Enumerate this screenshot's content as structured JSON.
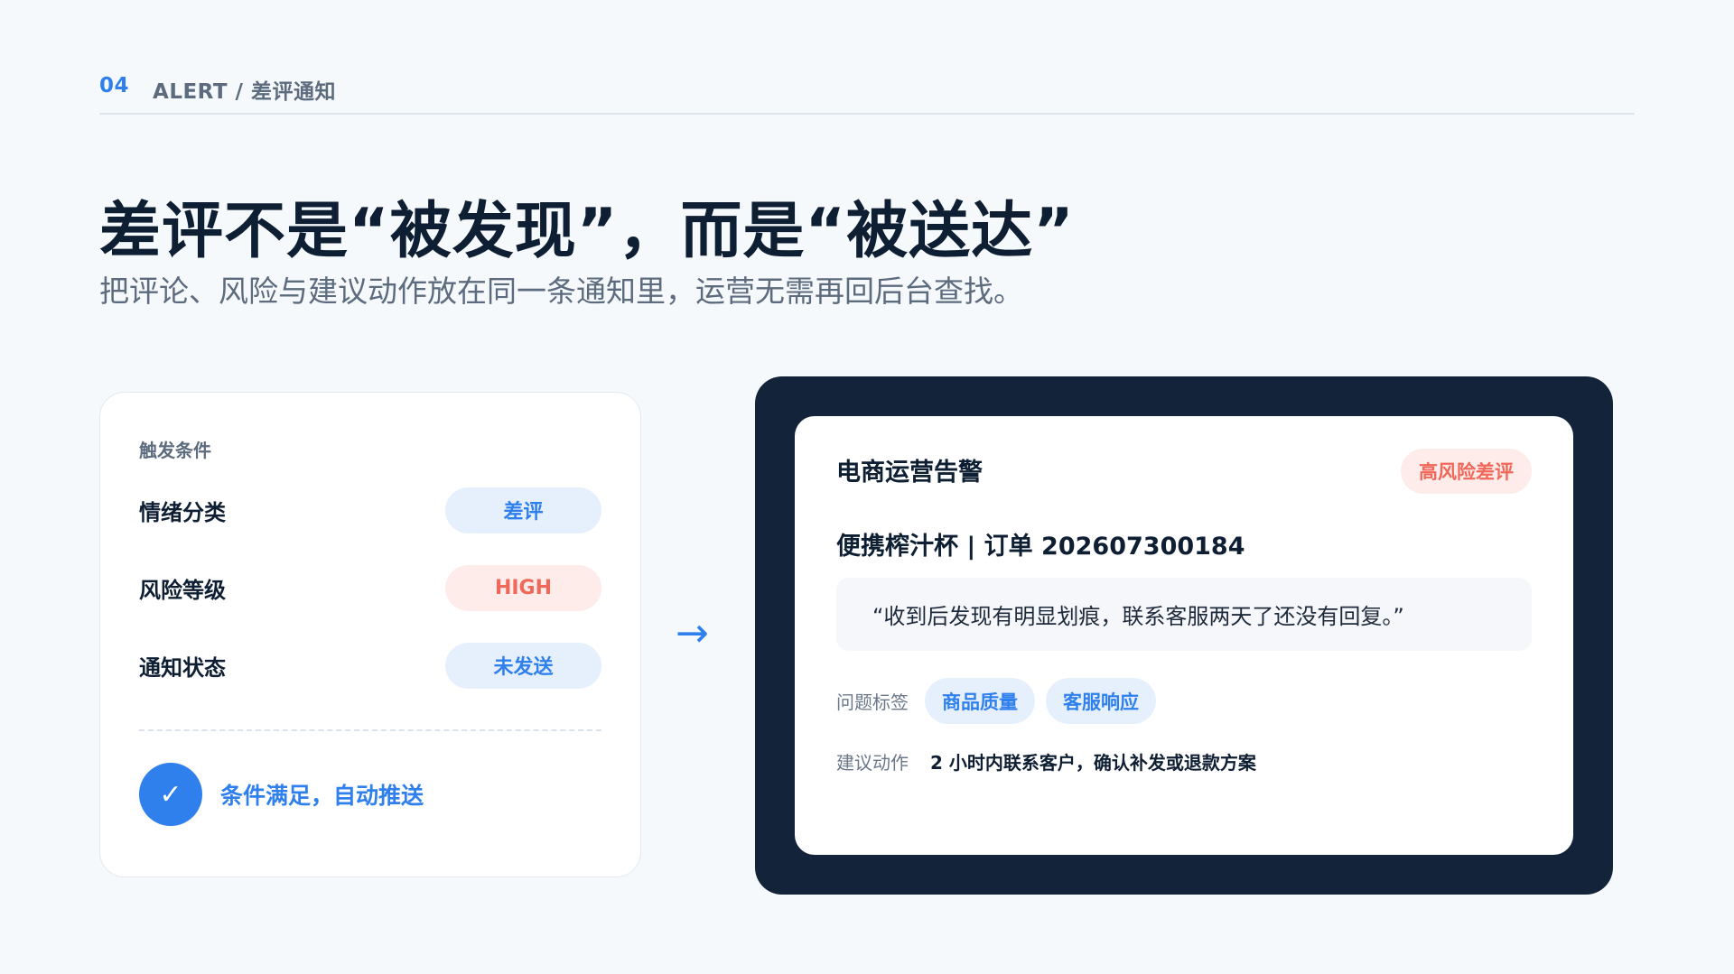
{
  "header": {
    "section_number": "04",
    "breadcrumb": "ALERT / 差评通知"
  },
  "headline": "差评不是“被发现”，而是“被送达”",
  "subheadline": "把评论、风险与建议动作放在同一条通知里，运营无需再回后台查找。",
  "trigger_card": {
    "title": "触发条件",
    "rows": [
      {
        "label": "情绪分类",
        "value": "差评",
        "tone": "blue"
      },
      {
        "label": "风险等级",
        "value": "HIGH",
        "tone": "red"
      },
      {
        "label": "通知状态",
        "value": "未发送",
        "tone": "blue"
      }
    ],
    "result_icon": "check-icon",
    "result_text": "条件满足，自动推送"
  },
  "flow_arrow": "→",
  "notification": {
    "title": "电商运营告警",
    "risk_badge": "高风险差评",
    "product_line": "便携榨汁杯 | 订单 202607300184",
    "quote": "“收到后发现有明显划痕，联系客服两天了还没有回复。”",
    "tags_label": "问题标签",
    "tags": [
      "商品质量",
      "客服响应"
    ],
    "action_label": "建议动作",
    "action_text": "2 小时内联系客户，确认补发或退款方案"
  },
  "colors": {
    "accent": "#2f80ed",
    "danger": "#f0685a",
    "dark_frame": "#13233a",
    "background": "#f6f9fc"
  }
}
